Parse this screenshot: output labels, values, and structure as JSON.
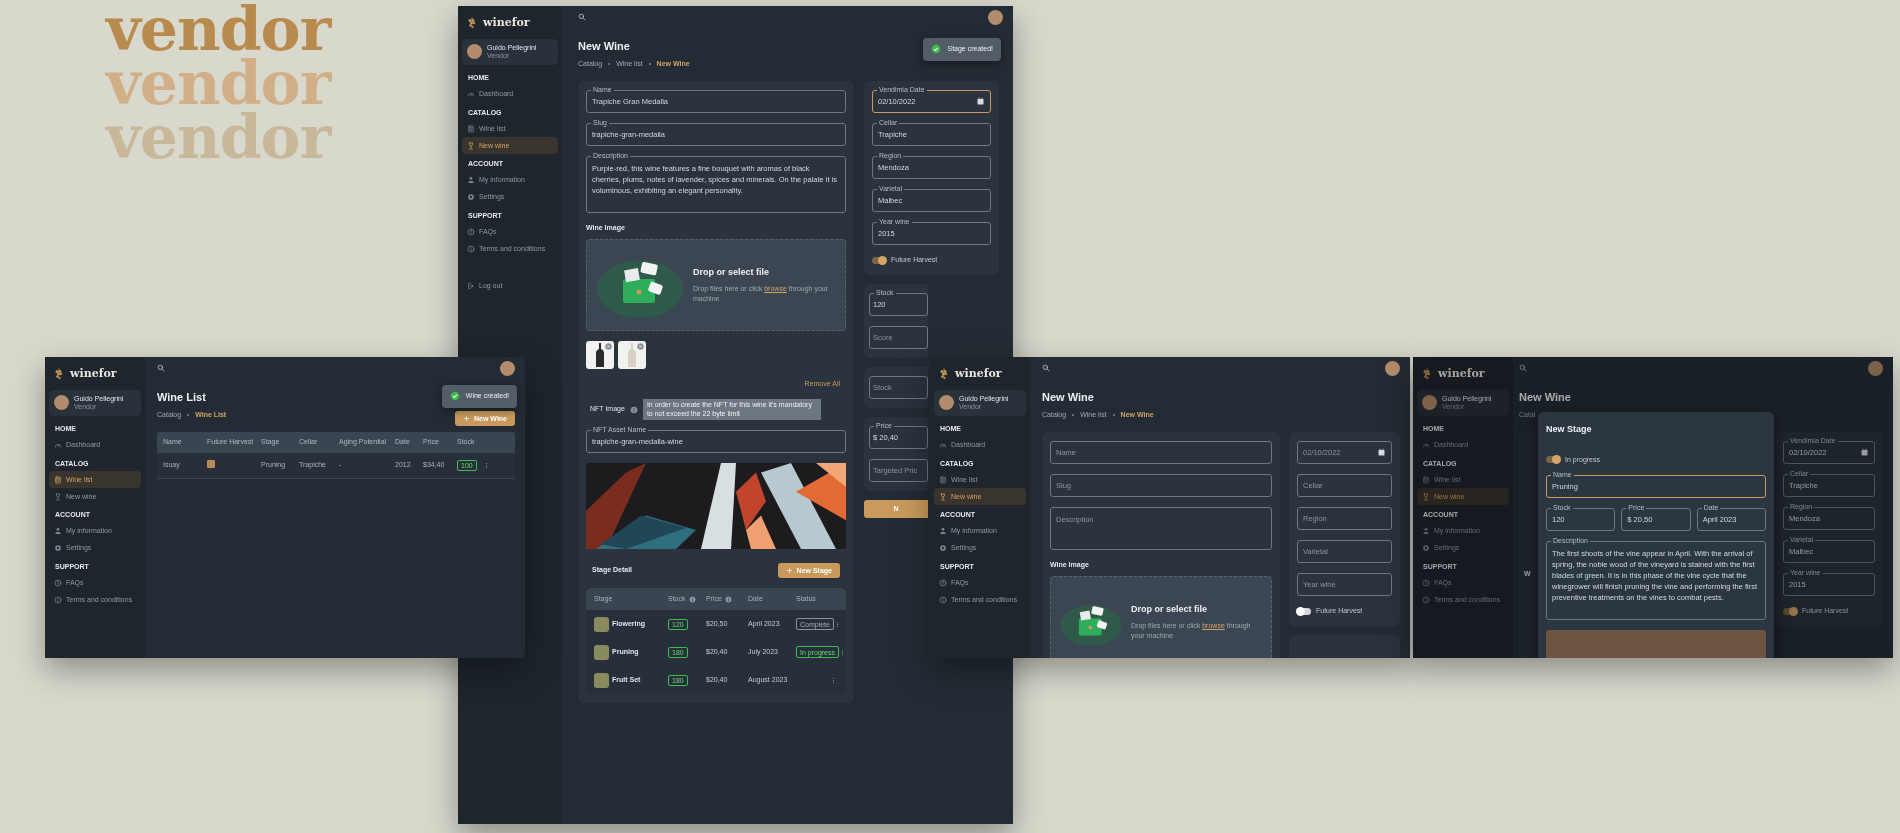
{
  "headline": [
    "vendor",
    "vendor",
    "vendor"
  ],
  "wine_list_window": {
    "sidebar": {
      "brand": "winefor",
      "user_name": "Guido Pellegrini",
      "user_role": "Vendor",
      "sections": [
        {
          "title": "HOME",
          "items": [
            {
              "label": "Dashboard",
              "selected": false
            }
          ]
        },
        {
          "title": "CATALOG",
          "items": [
            {
              "label": "Wine list",
              "selected": true
            },
            {
              "label": "New wine",
              "selected": false
            }
          ]
        },
        {
          "title": "ACCOUNT",
          "items": [
            {
              "label": "My information",
              "selected": false
            },
            {
              "label": "Settings",
              "selected": false
            }
          ]
        },
        {
          "title": "SUPPORT",
          "items": [
            {
              "label": "FAQs",
              "selected": false
            },
            {
              "label": "Terms and conditions",
              "selected": false
            }
          ]
        }
      ]
    },
    "title": "Wine List",
    "breadcrumb": [
      {
        "label": "Catalog",
        "selected": false
      },
      {
        "label": "Wine List",
        "selected": true
      }
    ],
    "toast": "Wine created!",
    "new_button": "New Wine",
    "table": {
      "columns": [
        "Name",
        "Future Harvest",
        "Stage",
        "Cellar",
        "Aging Potential",
        "Date",
        "Price",
        "Stock"
      ],
      "rows": [
        {
          "name": "Isuay",
          "future_harvest": true,
          "stage": "Pruning",
          "cellar": "Trapiche",
          "aging_potential": "-",
          "date": "2012",
          "price": "$34,40",
          "stock": "100"
        }
      ]
    }
  },
  "new_wine_window": {
    "sidebar": {
      "brand": "winefor",
      "user_name": "Guido Pellegrini",
      "user_role": "Vendor",
      "sections": [
        {
          "title": "HOME",
          "items": [
            {
              "label": "Dashboard",
              "selected": false
            }
          ]
        },
        {
          "title": "CATALOG",
          "items": [
            {
              "label": "Wine list",
              "selected": false
            },
            {
              "label": "New wine",
              "selected": true
            }
          ]
        },
        {
          "title": "ACCOUNT",
          "items": [
            {
              "label": "My information",
              "selected": false
            },
            {
              "label": "Settings",
              "selected": false
            }
          ]
        },
        {
          "title": "SUPPORT",
          "items": [
            {
              "label": "FAQs",
              "selected": false
            },
            {
              "label": "Terms and conditions",
              "selected": false
            }
          ]
        }
      ],
      "logout": "Log out"
    },
    "title": "New Wine",
    "breadcrumb": [
      {
        "label": "Catalog",
        "selected": false
      },
      {
        "label": "Wine list",
        "selected": false
      },
      {
        "label": "New Wine",
        "selected": true
      }
    ],
    "toast": "Stage created!",
    "form": {
      "fields": [
        {
          "kind": "text",
          "label": "Name",
          "value": "Trapiche Gran Medalla",
          "focused": false
        },
        {
          "kind": "text",
          "label": "Slug",
          "value": "trapiche-gran-medalla",
          "focused": false
        },
        {
          "kind": "textarea",
          "label": "Description",
          "value": "Purple-red, this wine features a fine bouquet with aromas of black cherries, plums, notes of lavender, spices and minerals. On the palate it is voluminous, exhibiting an elegant personality.",
          "focused": false
        }
      ],
      "image_label": "Wine Image",
      "dropzone": {
        "title": "Drop or select file",
        "hint_before": "Drop files here or click ",
        "link": "browse",
        "hint_after": " through your machine"
      },
      "thumbnails": [
        {
          "kind": "dark_bottle"
        },
        {
          "kind": "light_bottle"
        }
      ],
      "remove_all": "Remove All",
      "nft_label": "NFT Image",
      "nft_tooltip": "In order to create the NFT for this wine it's mandatory to not exceed the 22 byte limit",
      "nft_field": {
        "kind": "text",
        "label": "NFT Asset Name",
        "value": "trapiche-gran-medalla-wine",
        "focused": false
      },
      "stage_title": "Stage Detail",
      "new_stage_button": "New Stage",
      "stages": {
        "columns": [
          {
            "label": "Stage",
            "info": false
          },
          {
            "label": "Stock",
            "info": true
          },
          {
            "label": "Price",
            "info": true
          },
          {
            "label": "Date",
            "info": false
          },
          {
            "label": "Status",
            "info": false
          }
        ],
        "rows": [
          {
            "stage": "Flowering",
            "stock": "120",
            "price": "$20,50",
            "date": "April 2023",
            "status": {
              "kind": "complete",
              "label": "Complete"
            }
          },
          {
            "stage": "Pruning",
            "stock": "180",
            "price": "$20,40",
            "date": "July 2023",
            "status": {
              "kind": "in_progress",
              "label": "In progress"
            }
          },
          {
            "stage": "Fruit Set",
            "stock": "180",
            "price": "$20,40",
            "date": "August 2023"
          }
        ]
      }
    },
    "side_cards": [
      {
        "fields": [
          {
            "kind": "date",
            "label": "Vendimia Date",
            "value": "02/10/2022",
            "focused": true
          },
          {
            "kind": "text",
            "label": "Cellar",
            "value": "Trapiche",
            "focused": false
          },
          {
            "kind": "text",
            "label": "Region",
            "value": "Mendoza",
            "focused": false
          },
          {
            "kind": "text",
            "label": "Varietal",
            "value": "Malbec",
            "focused": false
          },
          {
            "kind": "text",
            "label": "Year wine",
            "value": "2015",
            "focused": false
          }
        ],
        "toggle": {
          "label": "Future Harvest",
          "on": true
        }
      },
      {
        "fields": [
          {
            "kind": "text",
            "label": "Stock",
            "value": "120",
            "focused": false
          },
          {
            "kind": "text",
            "placeholder": "Score",
            "focused": false
          }
        ]
      },
      {
        "fields": [
          {
            "kind": "text",
            "placeholder": "Stock",
            "focused": false
          }
        ]
      },
      {
        "fields": [
          {
            "kind": "text",
            "label": "Price",
            "value": "$ 20,40",
            "focused": false
          },
          {
            "kind": "text",
            "placeholder": "Targeted Pric",
            "focused": false
          }
        ]
      }
    ],
    "submit_button": "N"
  },
  "empty_form_window": {
    "sidebar": {
      "brand": "winefor",
      "user_name": "Guido Pellegrini",
      "user_role": "Vendor",
      "sections": [
        {
          "title": "HOME",
          "items": [
            {
              "label": "Dashboard",
              "selected": false
            }
          ]
        },
        {
          "title": "CATALOG",
          "items": [
            {
              "label": "Wine list",
              "selected": false
            },
            {
              "label": "New wine",
              "selected": true
            }
          ]
        },
        {
          "title": "ACCOUNT",
          "items": [
            {
              "label": "My information",
              "selected": false
            },
            {
              "label": "Settings",
              "selected": false
            }
          ]
        },
        {
          "title": "SUPPORT",
          "items": [
            {
              "label": "FAQs",
              "selected": false
            },
            {
              "label": "Terms and conditions",
              "selected": false
            }
          ]
        }
      ]
    },
    "title": "New Wine",
    "breadcrumb": [
      {
        "label": "Catalog",
        "selected": false
      },
      {
        "label": "Wine list",
        "selected": false
      },
      {
        "label": "New Wine",
        "selected": true
      }
    ],
    "fields": [
      {
        "kind": "text",
        "placeholder": "Name",
        "focused": false
      },
      {
        "kind": "text",
        "placeholder": "Slug",
        "focused": false
      },
      {
        "kind": "textarea",
        "placeholder": "Description",
        "focused": false
      }
    ],
    "image_label": "Wine Image",
    "dropzone": {
      "title": "Drop or select file",
      "hint_before": "Drop files here or click ",
      "link": "browse",
      "hint_after": " through your machine"
    },
    "side_fields": [
      {
        "kind": "date",
        "placeholder": "02/10/2022",
        "focused": false
      },
      {
        "kind": "text",
        "placeholder": "Cellar",
        "focused": false
      },
      {
        "kind": "text",
        "placeholder": "Region",
        "focused": false
      },
      {
        "kind": "text",
        "placeholder": "Varietal",
        "focused": false
      },
      {
        "kind": "text",
        "placeholder": "Year wine",
        "focused": false
      }
    ],
    "toggle": {
      "label": "Future Harvest",
      "on": false
    }
  },
  "new_stage_window": {
    "sidebar": {
      "brand": "winefor",
      "user_name": "Guido Pellegrini",
      "user_role": "Vendor",
      "sections": [
        {
          "title": "HOME",
          "items": [
            {
              "label": "Dashboard",
              "selected": false
            }
          ]
        },
        {
          "title": "CATALOG",
          "items": [
            {
              "label": "Wine list",
              "selected": false
            },
            {
              "label": "New wine",
              "selected": true
            }
          ]
        },
        {
          "title": "ACCOUNT",
          "items": [
            {
              "label": "My information",
              "selected": false
            },
            {
              "label": "Settings",
              "selected": false
            }
          ]
        },
        {
          "title": "SUPPORT",
          "items": [
            {
              "label": "FAQs",
              "selected": false
            },
            {
              "label": "Terms and conditions",
              "selected": false
            }
          ]
        }
      ]
    },
    "title": "New Wine",
    "breadcrumb_fragment": "Catal",
    "image_label_fragment": "W",
    "side_fields": [
      {
        "kind": "date",
        "label": "Vendimia Date",
        "value": "02/10/2022",
        "focused": false
      },
      {
        "kind": "text",
        "label": "Cellar",
        "value": "Trapiche",
        "focused": false
      },
      {
        "kind": "text",
        "label": "Region",
        "value": "Mendoza",
        "focused": false
      },
      {
        "kind": "text",
        "label": "Varietal",
        "value": "Malbec",
        "focused": false
      },
      {
        "kind": "text",
        "label": "Year wine",
        "value": "2015",
        "focused": false
      }
    ],
    "toggle": {
      "label": "Future Harvest",
      "on": true
    },
    "modal": {
      "title": "New Stage",
      "toggle": {
        "label": "In progress",
        "on": true
      },
      "name_field": {
        "kind": "text",
        "label": "Name",
        "value": "Pruning",
        "focused": true
      },
      "row_fields": [
        {
          "kind": "text",
          "label": "Stock",
          "value": "120",
          "focused": false
        },
        {
          "kind": "text",
          "label": "Price",
          "value": "$ 20,50",
          "focused": false
        },
        {
          "kind": "text",
          "label": "Date",
          "value": "April 2023",
          "focused": false
        }
      ],
      "description": {
        "kind": "textarea",
        "label": "Description",
        "value": "The first shoots of the vine appear in April. With the arrival of spring, the noble wood of the vineyard is stained with the first blades of green. It is in this phase of the vine cycle that the winegrower will finish pruning the vine and performing the first preventive treatments on the vines to combat pests.",
        "focused": false
      }
    }
  }
}
